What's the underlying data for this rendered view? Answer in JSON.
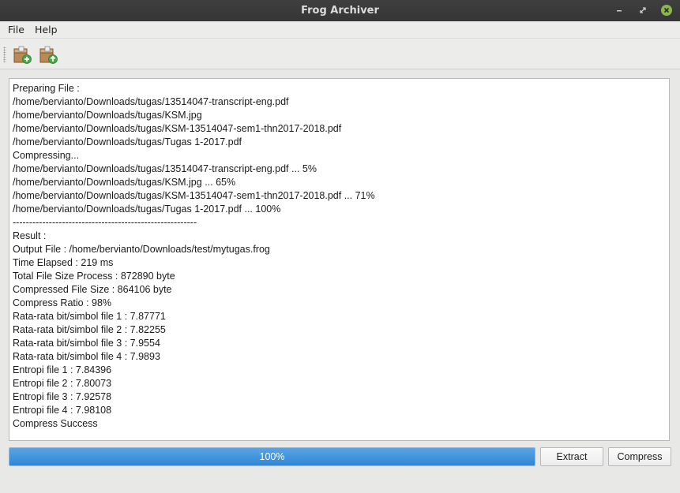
{
  "window": {
    "title": "Frog Archiver"
  },
  "menu": {
    "items": [
      "File",
      "Help"
    ]
  },
  "toolbar": {
    "buttons": [
      "add-archive-icon",
      "extract-archive-icon"
    ]
  },
  "log": {
    "lines": [
      "Preparing File :",
      "/home/bervianto/Downloads/tugas/13514047-transcript-eng.pdf",
      "/home/bervianto/Downloads/tugas/KSM.jpg",
      "/home/bervianto/Downloads/tugas/KSM-13514047-sem1-thn2017-2018.pdf",
      "/home/bervianto/Downloads/tugas/Tugas 1-2017.pdf",
      "Compressing...",
      "/home/bervianto/Downloads/tugas/13514047-transcript-eng.pdf ... 5%",
      "/home/bervianto/Downloads/tugas/KSM.jpg ... 65%",
      "/home/bervianto/Downloads/tugas/KSM-13514047-sem1-thn2017-2018.pdf ... 71%",
      "/home/bervianto/Downloads/tugas/Tugas 1-2017.pdf ... 100%",
      "--------------------------------------------------------",
      "Result :",
      "Output File : /home/bervianto/Downloads/test/mytugas.frog",
      "Time Elapsed : 219 ms",
      "Total File Size Process : 872890 byte",
      "Compressed File Size : 864106 byte",
      "Compress Ratio : 98%",
      "Rata-rata bit/simbol file 1 : 7.87771",
      "Rata-rata bit/simbol file 2 : 7.82255",
      "Rata-rata bit/simbol file 3 : 7.9554",
      "Rata-rata bit/simbol file 4 : 7.9893",
      "Entropi file 1 : 7.84396",
      "Entropi file 2 : 7.80073",
      "Entropi file 3 : 7.92578",
      "Entropi file 4 : 7.98108",
      "Compress Success"
    ]
  },
  "progress": {
    "value": 1.0,
    "label": "100%"
  },
  "buttons": {
    "extract": "Extract",
    "compress": "Compress"
  },
  "colors": {
    "progress_fill": "#2f86d6",
    "close_button": "#8ab84a",
    "titlebar": "#3a3a3a"
  }
}
